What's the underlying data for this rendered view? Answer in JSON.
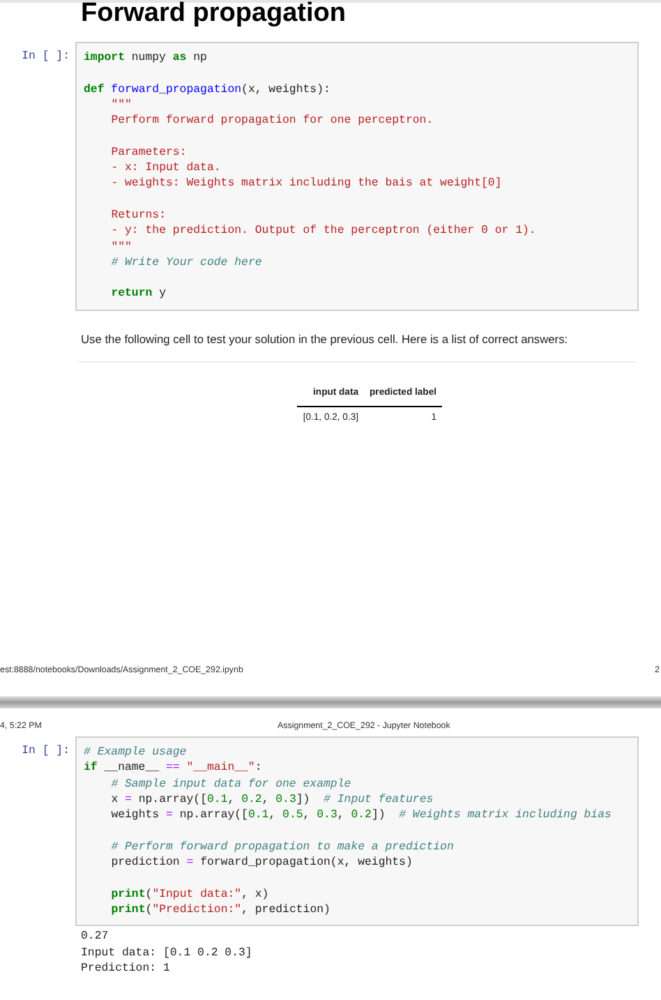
{
  "page1": {
    "heading": "Forward propagation",
    "cell1": {
      "prompt": "In [ ]:",
      "blocks": [
        [
          {
            "indented": false,
            "tokens": [
              {
                "text": "import",
                "kind": "kw"
              },
              {
                "text": " numpy ",
                "kind": "plain"
              },
              {
                "text": "as",
                "kind": "kw"
              },
              {
                "text": " np",
                "kind": "plain"
              }
            ]
          }
        ],
        [
          {
            "indented": false,
            "tokens": [
              {
                "text": "def",
                "kind": "kw"
              },
              {
                "text": " forward_propagation",
                "kind": "fn"
              },
              {
                "text": "(x, weights):",
                "kind": "plain"
              }
            ]
          },
          {
            "indented": true,
            "tokens": [
              {
                "text": "\"\"\"",
                "kind": "str"
              }
            ]
          },
          {
            "indented": true,
            "tokens": [
              {
                "text": "Perform forward propagation for one perceptron.",
                "kind": "str"
              }
            ]
          }
        ],
        [
          {
            "indented": true,
            "tokens": [
              {
                "text": "Parameters:",
                "kind": "str"
              }
            ]
          },
          {
            "indented": true,
            "tokens": [
              {
                "text": "- x: Input data.",
                "kind": "str"
              }
            ]
          },
          {
            "indented": true,
            "tokens": [
              {
                "text": "- weights: Weights matrix including the bais at weight[0]",
                "kind": "str"
              }
            ]
          }
        ],
        [
          {
            "indented": true,
            "tokens": [
              {
                "text": "Returns:",
                "kind": "str"
              }
            ]
          },
          {
            "indented": true,
            "tokens": [
              {
                "text": "- y: the prediction. Output of the perceptron (either 0 or 1).",
                "kind": "str"
              }
            ]
          },
          {
            "indented": true,
            "tokens": [
              {
                "text": "\"\"\"",
                "kind": "str"
              }
            ]
          },
          {
            "indented": true,
            "tokens": [
              {
                "text": "# Write Your code here",
                "kind": "com"
              }
            ]
          }
        ],
        [
          {
            "indented": true,
            "tokens": [
              {
                "text": "return",
                "kind": "kw"
              },
              {
                "text": " y",
                "kind": "plain"
              }
            ]
          }
        ]
      ]
    },
    "instruction": "Use the following cell to test your solution in the previous cell. Here is a list of correct answers:",
    "table": {
      "columns": [
        "input data",
        "predicted label"
      ],
      "rows": [
        [
          "[0.1, 0.2, 0.3]",
          "1"
        ]
      ]
    },
    "footer": {
      "url": "est:8888/notebooks/Downloads/Assignment_2_COE_292.ipynb",
      "page": "2"
    }
  },
  "page2": {
    "header": {
      "date": "4, 5:22 PM",
      "title": "Assignment_2_COE_292 - Jupyter Notebook"
    },
    "cell2": {
      "prompt": "In [ ]:",
      "blocks": [
        [
          {
            "indented": false,
            "tokens": [
              {
                "text": "# Example usage",
                "kind": "com"
              }
            ]
          },
          {
            "indented": false,
            "tokens": [
              {
                "text": "if",
                "kind": "kw"
              },
              {
                "text": " __name__ ",
                "kind": "plain"
              },
              {
                "text": "==",
                "kind": "op"
              },
              {
                "text": " \"__main__\"",
                "kind": "str"
              },
              {
                "text": ":",
                "kind": "plain"
              }
            ]
          },
          {
            "indented": true,
            "tokens": [
              {
                "text": "# Sample input data for one example",
                "kind": "com"
              }
            ]
          },
          {
            "indented": true,
            "tokens": [
              {
                "text": "x ",
                "kind": "plain"
              },
              {
                "text": "=",
                "kind": "op"
              },
              {
                "text": " np.array([",
                "kind": "plain"
              },
              {
                "text": "0.1",
                "kind": "num"
              },
              {
                "text": ", ",
                "kind": "plain"
              },
              {
                "text": "0.2",
                "kind": "num"
              },
              {
                "text": ", ",
                "kind": "plain"
              },
              {
                "text": "0.3",
                "kind": "num"
              },
              {
                "text": "])  ",
                "kind": "plain"
              },
              {
                "text": "# Input features",
                "kind": "com"
              }
            ]
          },
          {
            "indented": true,
            "tokens": [
              {
                "text": "weights ",
                "kind": "plain"
              },
              {
                "text": "=",
                "kind": "op"
              },
              {
                "text": " np.array([",
                "kind": "plain"
              },
              {
                "text": "0.1",
                "kind": "num"
              },
              {
                "text": ", ",
                "kind": "plain"
              },
              {
                "text": "0.5",
                "kind": "num"
              },
              {
                "text": ", ",
                "kind": "plain"
              },
              {
                "text": "0.3",
                "kind": "num"
              },
              {
                "text": ", ",
                "kind": "plain"
              },
              {
                "text": "0.2",
                "kind": "num"
              },
              {
                "text": "])  ",
                "kind": "plain"
              },
              {
                "text": "# Weights matrix including bias",
                "kind": "com"
              }
            ]
          }
        ],
        [
          {
            "indented": true,
            "tokens": [
              {
                "text": "# Perform forward propagation to make a prediction",
                "kind": "com"
              }
            ]
          },
          {
            "indented": true,
            "tokens": [
              {
                "text": "prediction ",
                "kind": "plain"
              },
              {
                "text": "=",
                "kind": "op"
              },
              {
                "text": " forward_propagation(x, weights)",
                "kind": "plain"
              }
            ]
          }
        ],
        [
          {
            "indented": true,
            "tokens": [
              {
                "text": "print",
                "kind": "kw"
              },
              {
                "text": "(",
                "kind": "plain"
              },
              {
                "text": "\"Input data:\"",
                "kind": "str"
              },
              {
                "text": ", x)",
                "kind": "plain"
              }
            ]
          },
          {
            "indented": true,
            "tokens": [
              {
                "text": "print",
                "kind": "kw"
              },
              {
                "text": "(",
                "kind": "plain"
              },
              {
                "text": "\"Prediction:\"",
                "kind": "str"
              },
              {
                "text": ", prediction)",
                "kind": "plain"
              }
            ]
          }
        ]
      ]
    },
    "output": [
      "0.27",
      "Input data: [0.1 0.2 0.3]",
      "Prediction: 1"
    ]
  }
}
